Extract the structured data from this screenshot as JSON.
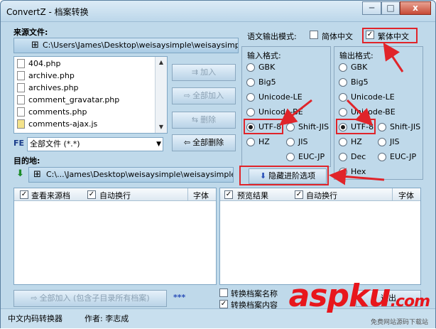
{
  "window": {
    "title": "ConvertZ - 档案转换",
    "minimize": "─",
    "maximize": "□",
    "close": "x"
  },
  "source": {
    "label": "来源文件:",
    "path": "C:\\Users\\James\\Desktop\\weisaysimple\\weisaysimple",
    "files": [
      "404.php",
      "archive.php",
      "archives.php",
      "comment_gravatar.php",
      "comments.php",
      "comments-ajax.js"
    ],
    "filter_badge": "FE",
    "filter_value": "全部文件 (*.*)"
  },
  "buttons": {
    "add": "加入",
    "add_all": "全部加入",
    "delete": "删除",
    "delete_all": "全部删除",
    "hide_advanced": "隐藏进阶选项",
    "add_all_subdirs": "全部加入 (包含子目录所有档案)",
    "stars": "***",
    "exit": "退出"
  },
  "destination": {
    "label": "目的地:",
    "path": "C:\\...\\James\\Desktop\\weisaysimple\\weisaysimple-new"
  },
  "output_mode": {
    "label": "语文输出模式:",
    "simplified": "简体中文",
    "simplified_checked": false,
    "traditional": "繁体中文",
    "traditional_checked": true
  },
  "input_format": {
    "title": "输入格式:",
    "options": [
      "GBK",
      "Big5",
      "Unicode-LE",
      "Unicode-BE",
      "UTF-8",
      "Shift-JIS",
      "HZ",
      "JIS",
      "EUC-JP"
    ],
    "selected": "UTF-8"
  },
  "output_format": {
    "title": "输出格式:",
    "options": [
      "GBK",
      "Big5",
      "Unicode-LE",
      "Unicode-BE",
      "UTF-8",
      "Shift-JIS",
      "HZ",
      "JIS",
      "Dec",
      "EUC-JP",
      "Hex"
    ],
    "selected": "UTF-8"
  },
  "left_pane": {
    "view_source": "查看来源档",
    "view_source_checked": true,
    "wrap": "自动换行",
    "wrap_checked": true,
    "font": "字体"
  },
  "right_pane": {
    "preview": "预览结果",
    "preview_checked": true,
    "wrap": "自动换行",
    "wrap_checked": true,
    "font": "字体"
  },
  "options": {
    "convert_name": "转换档案名称",
    "convert_name_checked": false,
    "convert_content": "转换档案内容",
    "convert_content_checked": true
  },
  "status": {
    "app": "中文内码转换器",
    "author": "作者: 李志成"
  },
  "watermark": {
    "main": "aspku",
    "suffix": ".com",
    "sub": "免费网站源码下载站"
  },
  "colors": {
    "highlight": "#e0242a",
    "window_bg": "#bfd9ea"
  }
}
